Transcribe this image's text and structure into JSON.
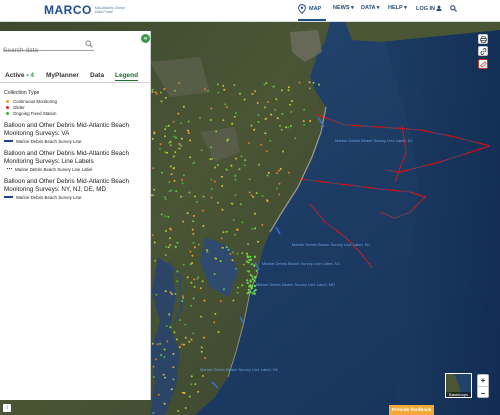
{
  "header": {
    "logo_word": "MARCO",
    "logo_sub": "Mid-Atlantic Ocean Data Portal",
    "nav": {
      "map": "MAP",
      "news": "NEWS ▾",
      "data": "DATA ▾",
      "help": "HELP ▾",
      "login": "LOG IN"
    }
  },
  "sidebar": {
    "search_placeholder": "Search data",
    "collapse_glyph": "«",
    "tabs": [
      {
        "label": "Active",
        "count": " • 4"
      },
      {
        "label": "MyPlanner"
      },
      {
        "label": "Data"
      },
      {
        "label": "Legend"
      }
    ],
    "legend": {
      "collection_type_title": "Collection Type",
      "collection_types": [
        {
          "label": "Continuous Monitoring",
          "color": "#e8a23a"
        },
        {
          "label": "Glider",
          "color": "#d62a2a"
        },
        {
          "label": "Ongoing Fixed Station",
          "color": "#4caf3a"
        }
      ],
      "sections": [
        {
          "title": "Balloon and Other Debris Mid-Atlantic Beach Monitoring Surveys: VA",
          "item": "Marine Debris Beach Survey Line"
        },
        {
          "title": "Balloon and Other Debris Mid-Atlantic Beach Monitoring Surveys: Line Labels",
          "item": "Marine Debris Beach Survey Line Label"
        },
        {
          "title": "Balloon and Other Debris Mid-Atlantic Beach Monitoring Surveys: NY, NJ, DE, MD",
          "item": "Marine Debris Beach Survey Line"
        }
      ]
    }
  },
  "map": {
    "labels": [
      "Marine Debris Beach Survey Line Label, NJ",
      "Marine Debris Beach Survey Line Label, NJ",
      "Marine Debris Beach Survey Line Label, NJ",
      "Marine Debris Beach Survey Line Label, MD",
      "Marine Debris Beach Survey Line Label, VA"
    ],
    "basemap_label": "Basemaps",
    "zoom_in": "+",
    "zoom_out": "−",
    "feedback_button": "Provide feedback",
    "info_glyph": "i"
  },
  "colors": {
    "brand": "#1f4e8c",
    "accent_green": "#3a9b4a",
    "glider_track": "#e11a1a",
    "feedback": "#f1a93a"
  }
}
